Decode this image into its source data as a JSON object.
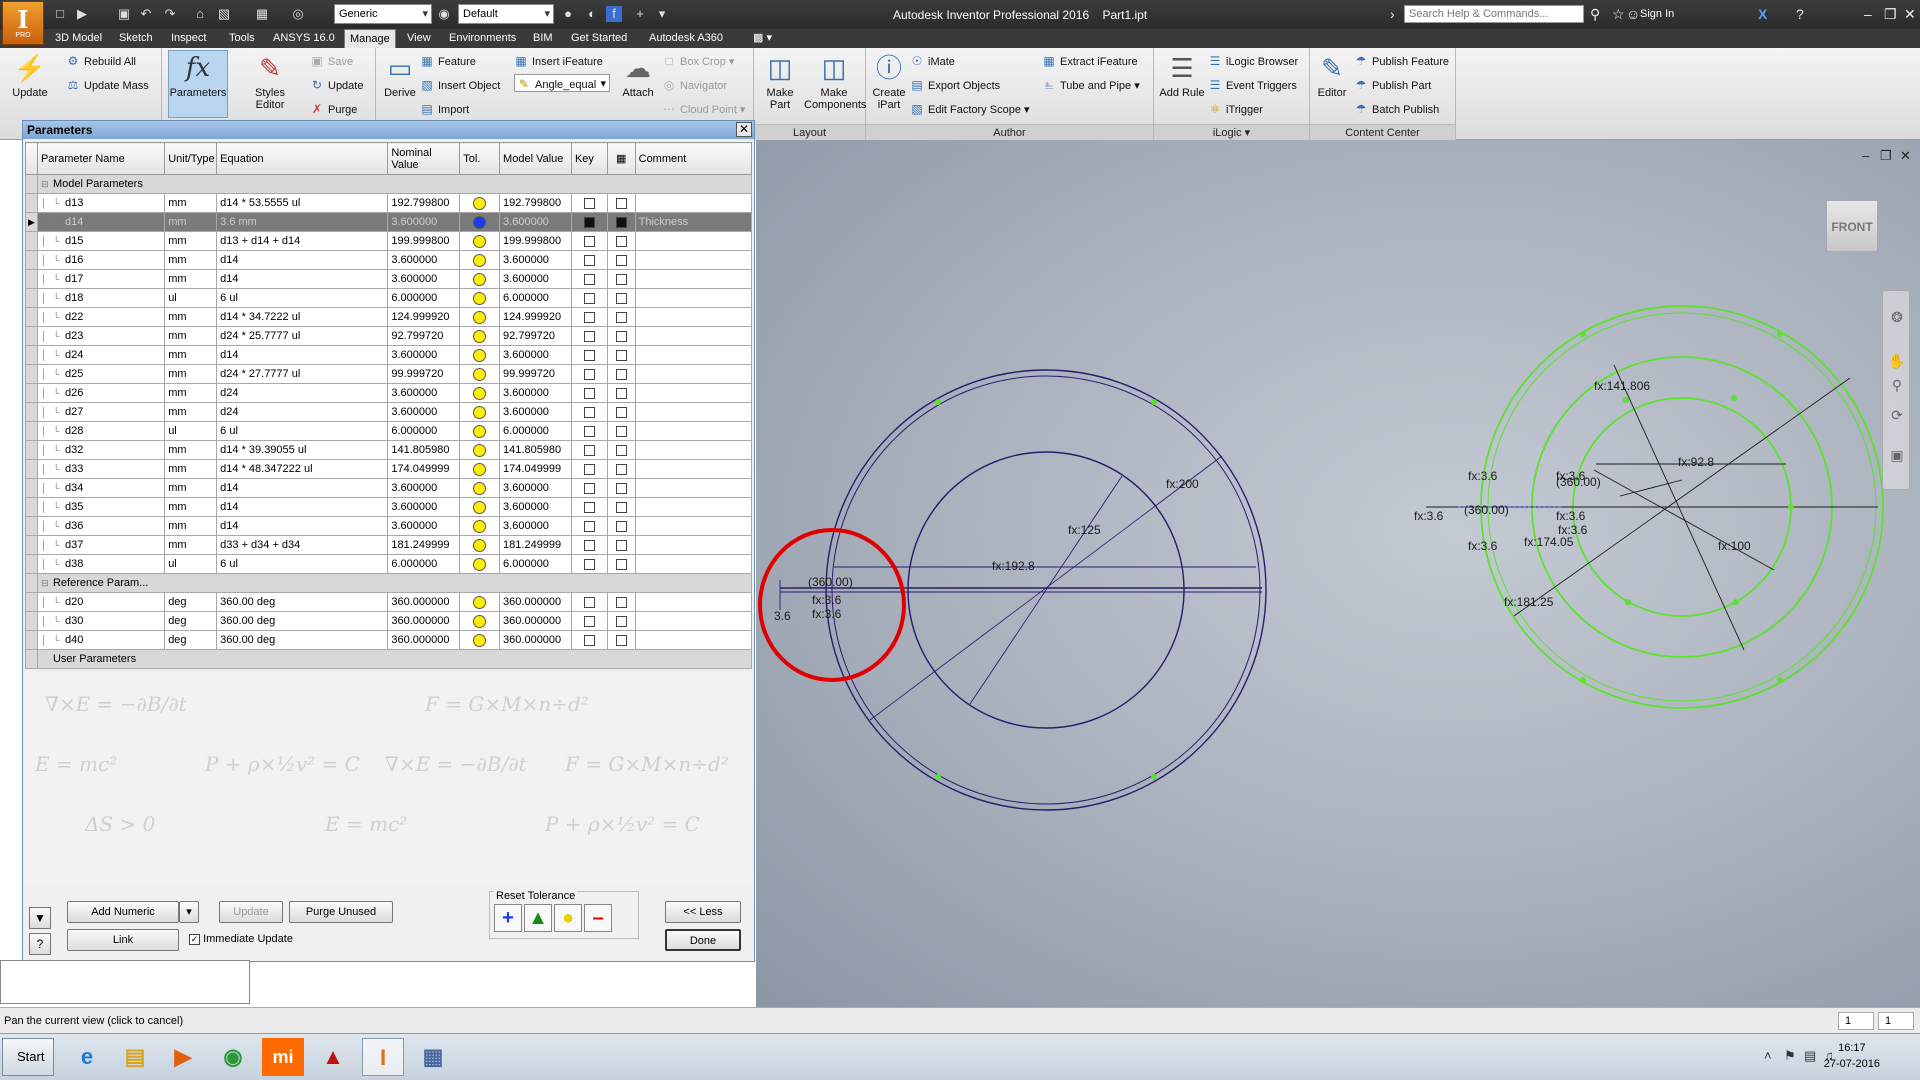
{
  "app": {
    "logo_text": "I",
    "logo_sub": "PRO",
    "title": "Autodesk Inventor Professional 2016    Part1.ipt",
    "material": "Generic",
    "appearance": "Default",
    "search_placeholder": "Search Help & Commands...",
    "sign_in": "Sign In"
  },
  "tabs": [
    {
      "label": "3D Model",
      "active": false
    },
    {
      "label": "Sketch",
      "active": false
    },
    {
      "label": "Inspect",
      "active": false
    },
    {
      "label": "Tools",
      "active": false
    },
    {
      "label": "ANSYS 16.0",
      "active": false
    },
    {
      "label": "Manage",
      "active": true
    },
    {
      "label": "View",
      "active": false
    },
    {
      "label": "Environments",
      "active": false
    },
    {
      "label": "BIM",
      "active": false
    },
    {
      "label": "Get Started",
      "active": false
    },
    {
      "label": "Autodesk A360",
      "active": false
    }
  ],
  "ribbon": {
    "update": "Update",
    "rebuild_all": "Rebuild All",
    "update_mass": "Update Mass",
    "parameters": "Parameters",
    "styles_editor": "Styles Editor",
    "save": "Save",
    "update2": "Update",
    "purge": "Purge",
    "derive": "Derive",
    "feature": "Feature",
    "insert_object": "Insert Object",
    "import": "Import",
    "insert_ifeature": "Insert iFeature",
    "angle_equal": "Angle_equal",
    "attach": "Attach",
    "box_crop": "Box Crop",
    "navigator": "Navigator",
    "cloud_point": "Cloud Point",
    "make_part": "Make Part",
    "make_components": "Make Components",
    "layout_label": "Layout",
    "create_ipart": "Create iPart",
    "imate": "iMate",
    "export_objects": "Export Objects",
    "edit_factory_scope": "Edit Factory Scope",
    "extract_ifeature": "Extract iFeature",
    "tube_and_pipe": "Tube and Pipe",
    "author_label": "Author",
    "add_rule": "Add Rule",
    "ilogic_browser": "iLogic Browser",
    "event_triggers": "Event Triggers",
    "itrigger": "iTrigger",
    "ilogic_label": "iLogic",
    "editor": "Editor",
    "publish_feature": "Publish Feature",
    "publish_part": "Publish Part",
    "batch_publish": "Batch Publish",
    "content_center_label": "Content Center"
  },
  "dialog": {
    "title": "Parameters",
    "columns": [
      "Parameter Name",
      "Unit/Type",
      "Equation",
      "Nominal Value",
      "Tol.",
      "Model Value",
      "Key",
      "",
      "Comment"
    ],
    "groups": {
      "model": "Model Parameters",
      "reference": "Reference Param...",
      "user": "User Parameters"
    },
    "model_rows": [
      {
        "name": "d13",
        "unit": "mm",
        "eq": "d14 * 53.5555 ul",
        "nominal": "192.799800",
        "model": "192.799800",
        "comment": ""
      },
      {
        "name": "d14",
        "unit": "mm",
        "eq": "3.6 mm",
        "nominal": "3.600000",
        "model": "3.600000",
        "comment": "Thickness",
        "selected": true
      },
      {
        "name": "d15",
        "unit": "mm",
        "eq": "d13 + d14 + d14",
        "nominal": "199.999800",
        "model": "199.999800",
        "comment": ""
      },
      {
        "name": "d16",
        "unit": "mm",
        "eq": "d14",
        "nominal": "3.600000",
        "model": "3.600000",
        "comment": ""
      },
      {
        "name": "d17",
        "unit": "mm",
        "eq": "d14",
        "nominal": "3.600000",
        "model": "3.600000",
        "comment": ""
      },
      {
        "name": "d18",
        "unit": "ul",
        "eq": "6 ul",
        "nominal": "6.000000",
        "model": "6.000000",
        "comment": ""
      },
      {
        "name": "d22",
        "unit": "mm",
        "eq": "d14 * 34.7222 ul",
        "nominal": "124.999920",
        "model": "124.999920",
        "comment": ""
      },
      {
        "name": "d23",
        "unit": "mm",
        "eq": "d24 * 25.7777 ul",
        "nominal": "92.799720",
        "model": "92.799720",
        "comment": ""
      },
      {
        "name": "d24",
        "unit": "mm",
        "eq": "d14",
        "nominal": "3.600000",
        "model": "3.600000",
        "comment": ""
      },
      {
        "name": "d25",
        "unit": "mm",
        "eq": "d24 * 27.7777 ul",
        "nominal": "99.999720",
        "model": "99.999720",
        "comment": ""
      },
      {
        "name": "d26",
        "unit": "mm",
        "eq": "d24",
        "nominal": "3.600000",
        "model": "3.600000",
        "comment": ""
      },
      {
        "name": "d27",
        "unit": "mm",
        "eq": "d24",
        "nominal": "3.600000",
        "model": "3.600000",
        "comment": ""
      },
      {
        "name": "d28",
        "unit": "ul",
        "eq": "6 ul",
        "nominal": "6.000000",
        "model": "6.000000",
        "comment": ""
      },
      {
        "name": "d32",
        "unit": "mm",
        "eq": "d14 * 39.39055 ul",
        "nominal": "141.805980",
        "model": "141.805980",
        "comment": ""
      },
      {
        "name": "d33",
        "unit": "mm",
        "eq": "d14 * 48.347222 ul",
        "nominal": "174.049999",
        "model": "174.049999",
        "comment": ""
      },
      {
        "name": "d34",
        "unit": "mm",
        "eq": "d14",
        "nominal": "3.600000",
        "model": "3.600000",
        "comment": ""
      },
      {
        "name": "d35",
        "unit": "mm",
        "eq": "d14",
        "nominal": "3.600000",
        "model": "3.600000",
        "comment": ""
      },
      {
        "name": "d36",
        "unit": "mm",
        "eq": "d14",
        "nominal": "3.600000",
        "model": "3.600000",
        "comment": ""
      },
      {
        "name": "d37",
        "unit": "mm",
        "eq": "d33 + d34 + d34",
        "nominal": "181.249999",
        "model": "181.249999",
        "comment": ""
      },
      {
        "name": "d38",
        "unit": "ul",
        "eq": "6 ul",
        "nominal": "6.000000",
        "model": "6.000000",
        "comment": ""
      }
    ],
    "reference_rows": [
      {
        "name": "d20",
        "unit": "deg",
        "eq": "360.00 deg",
        "nominal": "360.000000",
        "model": "360.000000",
        "comment": ""
      },
      {
        "name": "d30",
        "unit": "deg",
        "eq": "360.00 deg",
        "nominal": "360.000000",
        "model": "360.000000",
        "comment": ""
      },
      {
        "name": "d40",
        "unit": "deg",
        "eq": "360.00 deg",
        "nominal": "360.000000",
        "model": "360.000000",
        "comment": ""
      }
    ],
    "add_numeric": "Add Numeric",
    "update": "Update",
    "purge_unused": "Purge Unused",
    "link": "Link",
    "immediate_update": "Immediate Update",
    "reset_tolerance": "Reset Tolerance",
    "less": "<< Less",
    "done": "Done"
  },
  "sketch": {
    "left": {
      "dims": [
        "fx:200",
        "fx:125",
        "fx:192.8",
        "(360.00)",
        "fx:3.6",
        "fx:3.6",
        "3.6"
      ]
    },
    "right": {
      "dims": [
        "fx:141.806",
        "fx:92.8",
        "fx:3.6",
        "(360.00)",
        "(360.00)",
        "fx:3.6",
        "fx:3.6",
        "fx:3.6",
        "fx:3.6",
        "fx:3.6",
        "fx:174.05",
        "fx:100",
        "fx:181.25"
      ]
    },
    "sketch_color": "#2a1a6e",
    "green": "#5de22c",
    "highlight_red": "#e00000"
  },
  "viewcube": "FRONT",
  "status": {
    "text": "Pan the current view (click to cancel)",
    "num1": "1",
    "num2": "1"
  },
  "taskbar": {
    "start": "Start",
    "time": "16:17",
    "date": "27-07-2016"
  }
}
